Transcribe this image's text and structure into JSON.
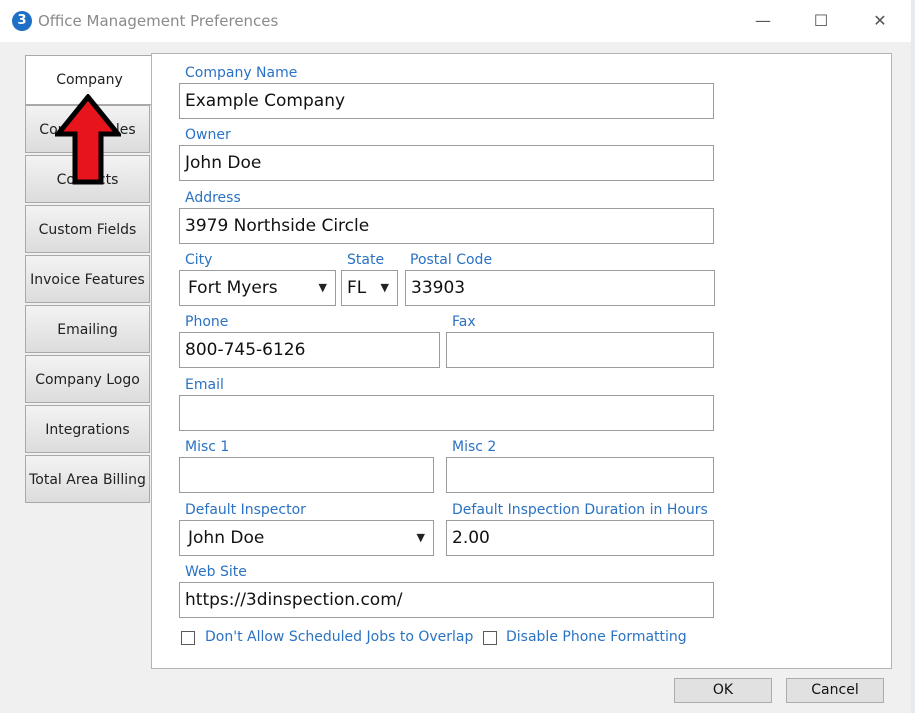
{
  "window": {
    "title": "Office Management Preferences",
    "app_icon_glyph": "3",
    "controls": {
      "minimize": "—",
      "maximize": "☐",
      "close": "✕"
    }
  },
  "tabs": [
    {
      "label": "Company",
      "active": true
    },
    {
      "label": "Contact Roles",
      "active": false
    },
    {
      "label": "Contacts",
      "active": false
    },
    {
      "label": "Custom Fields",
      "active": false
    },
    {
      "label": "Invoice Features",
      "active": false
    },
    {
      "label": "Emailing",
      "active": false
    },
    {
      "label": "Company Logo",
      "active": false
    },
    {
      "label": "Integrations",
      "active": false
    },
    {
      "label": "Total Area Billing",
      "active": false
    }
  ],
  "form": {
    "company_name": {
      "label": "Company Name",
      "value": "Example Company"
    },
    "owner": {
      "label": "Owner",
      "value": "John Doe"
    },
    "address": {
      "label": "Address",
      "value": "3979 Northside Circle"
    },
    "city": {
      "label": "City",
      "value": "Fort Myers"
    },
    "state": {
      "label": "State",
      "value": "FL"
    },
    "postal_code": {
      "label": "Postal Code",
      "value": "33903"
    },
    "phone": {
      "label": "Phone",
      "value": "800-745-6126"
    },
    "fax": {
      "label": "Fax",
      "value": ""
    },
    "email": {
      "label": "Email",
      "value": ""
    },
    "misc1": {
      "label": "Misc 1",
      "value": ""
    },
    "misc2": {
      "label": "Misc 2",
      "value": ""
    },
    "default_inspector": {
      "label": "Default Inspector",
      "value": "John Doe"
    },
    "default_duration": {
      "label": "Default Inspection Duration in Hours",
      "value": "2.00"
    },
    "web_site": {
      "label": "Web Site",
      "value": "https://3dinspection.com/"
    },
    "no_overlap": {
      "label": "Don't Allow Scheduled Jobs to Overlap",
      "checked": false
    },
    "disable_phone_format": {
      "label": "Disable Phone Formatting",
      "checked": false
    }
  },
  "buttons": {
    "ok": "OK",
    "cancel": "Cancel"
  },
  "colors": {
    "label_blue": "#2a72c3",
    "arrow_red": "#e8141c"
  },
  "annotation": {
    "arrow_icon": "red-arrow-up-icon"
  }
}
